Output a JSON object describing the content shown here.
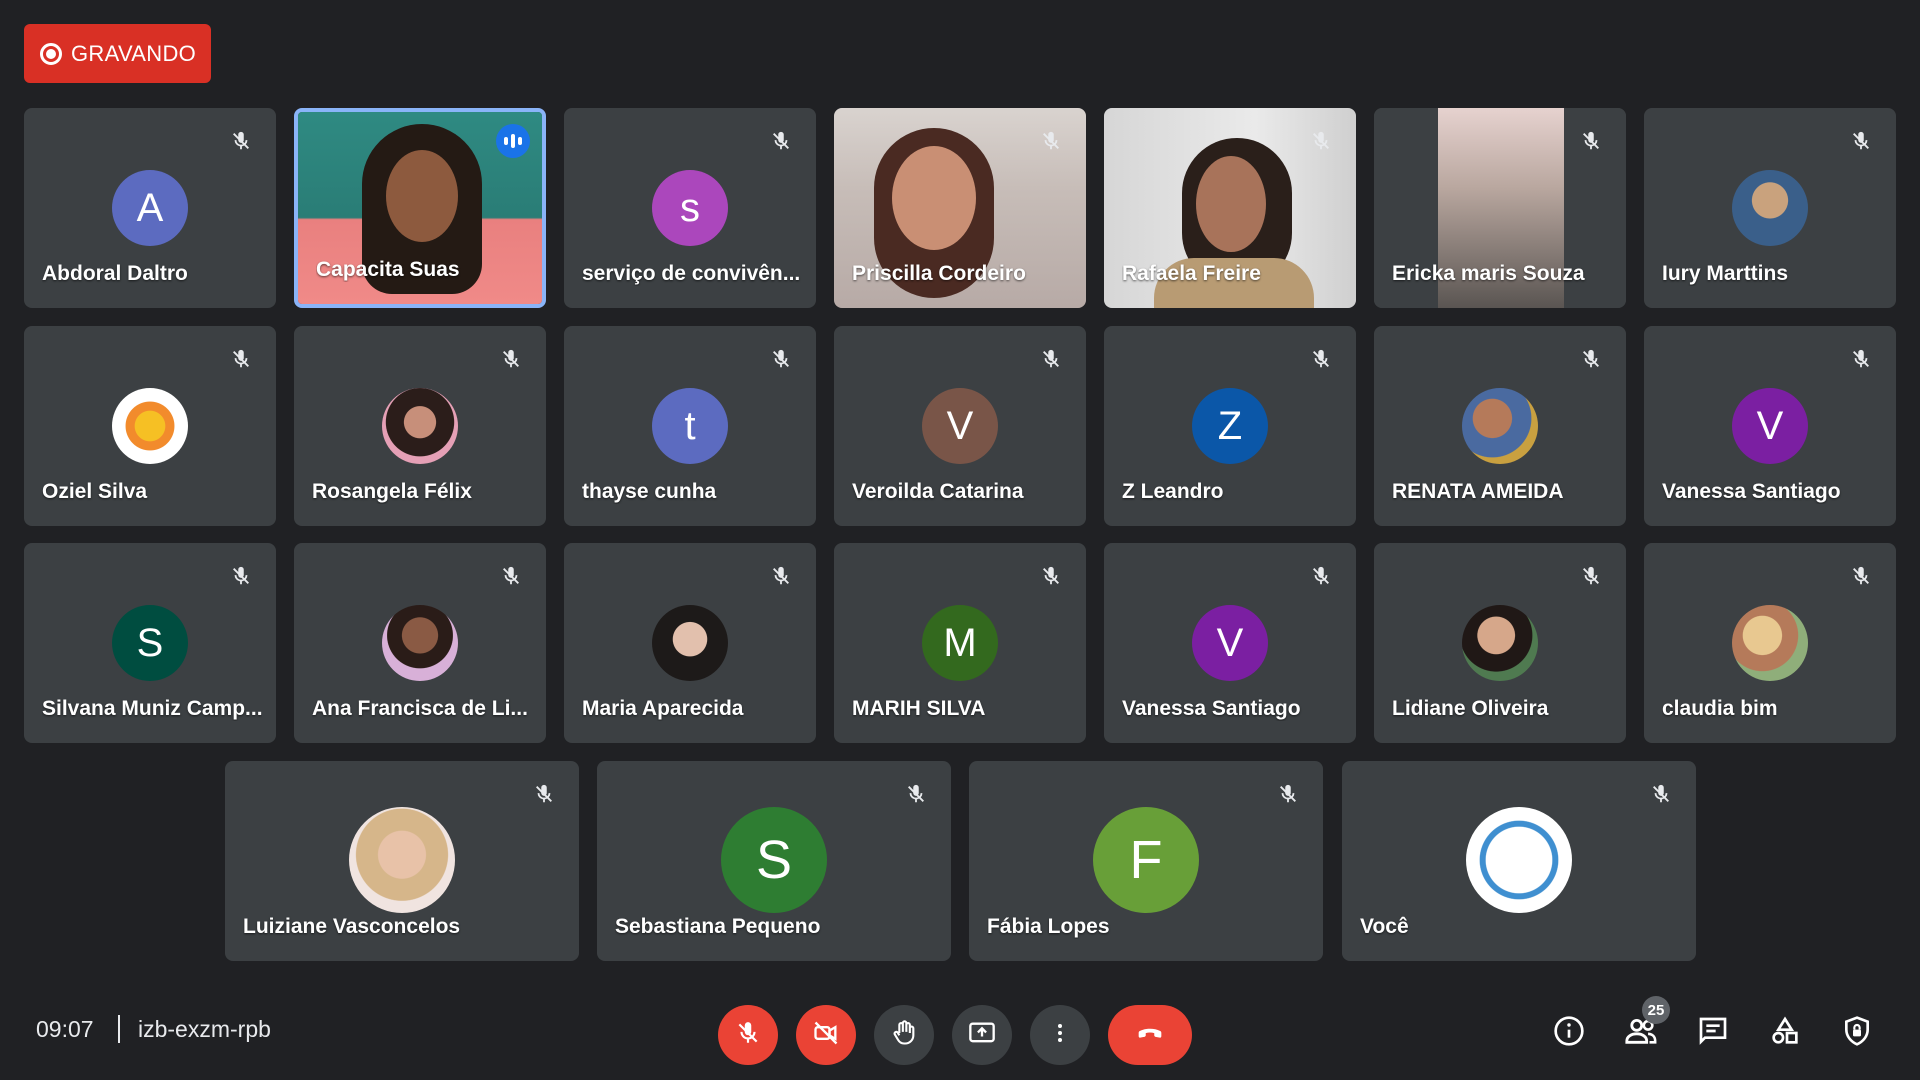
{
  "recording": {
    "label": "GRAVANDO"
  },
  "participants": [
    {
      "name": "Abdoral Daltro",
      "initial": "A",
      "color": "#5c6bc0"
    },
    {
      "name": "Capacita Suas"
    },
    {
      "name": "serviço de convivên...",
      "initial": "s",
      "color": "#ab47bc"
    },
    {
      "name": "Priscilla Cordeiro"
    },
    {
      "name": "Rafaela Freire"
    },
    {
      "name": "Ericka maris Souza"
    },
    {
      "name": "Iury Marttins"
    },
    {
      "name": "Oziel Silva"
    },
    {
      "name": "Rosangela Félix"
    },
    {
      "name": "thayse cunha",
      "initial": "t",
      "color": "#5c6bc0"
    },
    {
      "name": "Veroilda Catarina",
      "initial": "V",
      "color": "#795548"
    },
    {
      "name": "Z Leandro",
      "initial": "Z",
      "color": "#0b57a8"
    },
    {
      "name": "RENATA AMEIDA"
    },
    {
      "name": "Vanessa Santiago",
      "initial": "V",
      "color": "#7b1fa2"
    },
    {
      "name": "Silvana Muniz Camp...",
      "initial": "S",
      "color": "#004d40"
    },
    {
      "name": "Ana Francisca de Li..."
    },
    {
      "name": "Maria Aparecida"
    },
    {
      "name": "MARIH SILVA",
      "initial": "M",
      "color": "#33691e"
    },
    {
      "name": "Vanessa Santiago",
      "initial": "V",
      "color": "#7b1fa2"
    },
    {
      "name": "Lidiane Oliveira"
    },
    {
      "name": "claudia bim"
    },
    {
      "name": "Luiziane Vasconcelos"
    },
    {
      "name": "Sebastiana Pequeno",
      "initial": "S",
      "color": "#2e7d32"
    },
    {
      "name": "Fábia Lopes",
      "initial": "F",
      "color": "#689f38"
    },
    {
      "name": "Você"
    }
  ],
  "meeting": {
    "time": "09:07",
    "code": "izb-exzm-rpb"
  },
  "people_count": "25",
  "icons": {
    "mic_off": "mic-off-icon",
    "camera_off": "videocam-off-icon",
    "raise_hand": "hand-icon",
    "present": "present-screen-icon",
    "more": "more-vert-icon",
    "hangup": "call-end-icon",
    "info": "info-icon",
    "people": "people-icon",
    "chat": "chat-icon",
    "activities": "activities-icon",
    "host_controls": "shield-lock-icon"
  },
  "colors": {
    "recording": "#d93025",
    "end_call": "#ea4335",
    "speaking": "#8ab4f8"
  }
}
